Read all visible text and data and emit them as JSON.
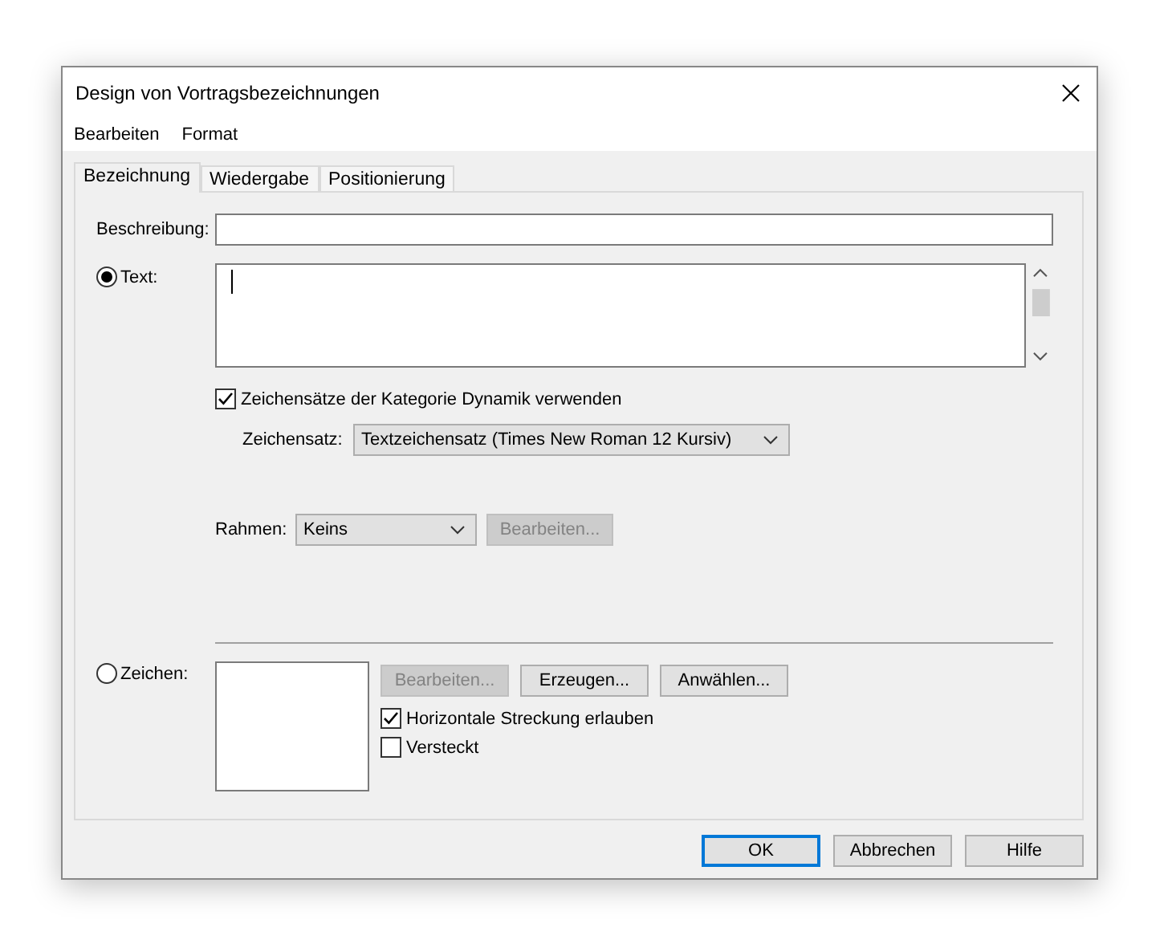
{
  "window": {
    "title": "Design von Vortragsbezeichnungen"
  },
  "menu": [
    "Bearbeiten",
    "Format"
  ],
  "tabs": [
    {
      "label": "Bezeichnung",
      "selected": true
    },
    {
      "label": "Wiedergabe",
      "selected": false
    },
    {
      "label": "Positionierung",
      "selected": false
    }
  ],
  "description": {
    "label": "Beschreibung:"
  },
  "text_option": {
    "label": "Text:",
    "selected": true
  },
  "use_dynamic_fonts": {
    "label": "Zeichensätze der Kategorie Dynamik verwenden",
    "checked": true
  },
  "font": {
    "label": "Zeichensatz:",
    "value": "Textzeichensatz (Times New Roman 12  Kursiv)"
  },
  "frame": {
    "label": "Rahmen:",
    "value": "Keins",
    "button": {
      "label": "Bearbeiten...",
      "disabled": true
    }
  },
  "symbol_option": {
    "label": "Zeichen:",
    "selected": false
  },
  "symbol_buttons": [
    {
      "label": "Bearbeiten...",
      "disabled": true
    },
    {
      "label": "Erzeugen...",
      "disabled": false
    },
    {
      "label": "Anwählen...",
      "disabled": false
    }
  ],
  "symbol_checks": [
    {
      "label": "Horizontale Streckung erlauben",
      "checked": true
    },
    {
      "label": "Versteckt",
      "checked": false
    }
  ],
  "buttons": [
    {
      "label": "OK",
      "default": true
    },
    {
      "label": "Abbrechen",
      "default": false
    },
    {
      "label": "Hilfe",
      "default": false
    }
  ]
}
